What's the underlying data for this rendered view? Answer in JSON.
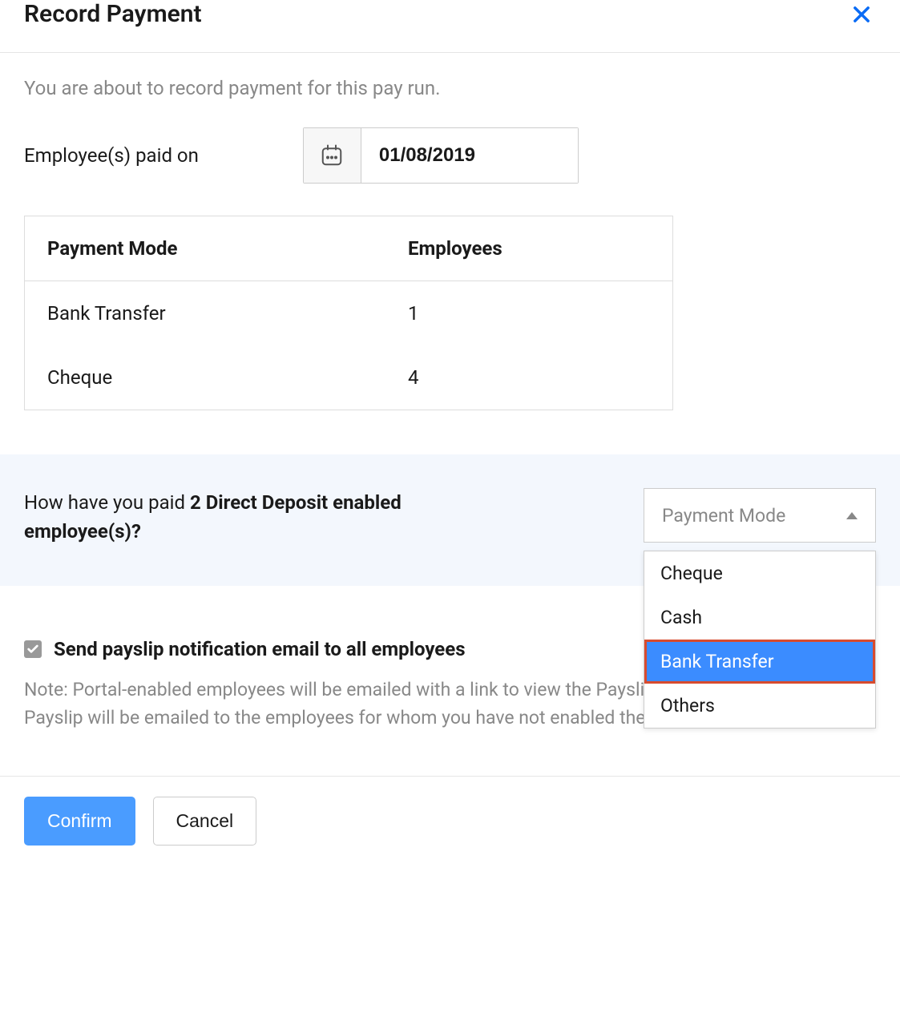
{
  "header": {
    "title": "Record Payment"
  },
  "intro_text": "You are about to record payment for this pay run.",
  "date_field": {
    "label": "Employee(s) paid on",
    "value": "01/08/2019"
  },
  "table": {
    "headers": {
      "mode": "Payment Mode",
      "employees": "Employees"
    },
    "rows": [
      {
        "mode": "Bank Transfer",
        "employees": "1"
      },
      {
        "mode": "Cheque",
        "employees": "4"
      }
    ]
  },
  "question": {
    "prefix": "How have you paid ",
    "bold": "2 Direct Deposit enabled employee(s)?"
  },
  "dropdown": {
    "placeholder": "Payment Mode",
    "options": [
      "Cheque",
      "Cash",
      "Bank Transfer",
      "Others"
    ],
    "highlighted_index": 2
  },
  "checkbox": {
    "label": "Send payslip notification email to all employees",
    "checked": true
  },
  "note_text": "Note: Portal-enabled employees will be emailed with a link to view the Payslip in the portal whereas Payslip will be emailed to the employees for whom you have not enabled the employee portal",
  "footer": {
    "confirm": "Confirm",
    "cancel": "Cancel"
  }
}
